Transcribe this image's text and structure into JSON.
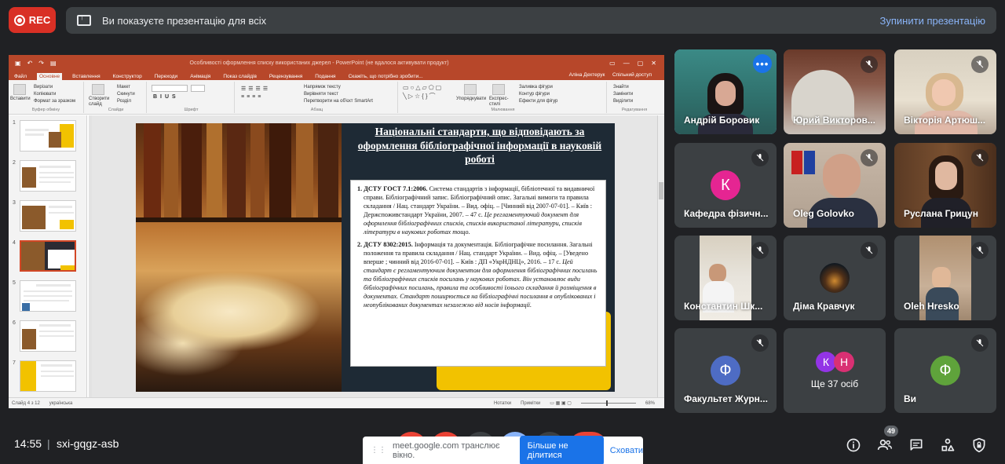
{
  "rec_label": "REC",
  "presenting": {
    "text": "Ви показуєте презентацію для всіх",
    "stop_label": "Зупинити презентацію"
  },
  "ppt": {
    "window_title": "Особливості оформлення списку використаних джерел - PowerPoint (не вдалося активувати продукт)",
    "user": "Аліна Дехтерук",
    "share": "Спільний доступ",
    "tabs": [
      "Файл",
      "Основне",
      "Вставлення",
      "Конструктор",
      "Переходи",
      "Анімація",
      "Показ слайдів",
      "Рецензування",
      "Подання"
    ],
    "tell_me": "Скажіть, що потрібно зробити...",
    "ribbon": {
      "paste": "Вставити",
      "cut": "Вирізати",
      "copy": "Копіювати",
      "format_painter": "Формат за зразком",
      "clipboard": "Буфер обміну",
      "new_slide": "Створити слайд",
      "layout": "Макет",
      "reset": "Скинути",
      "section": "Розділ",
      "slides": "Слайди",
      "font": "Шрифт",
      "text_dir": "Напрямок тексту",
      "align_text": "Вирівняти текст",
      "smartart": "Перетворити на об'єкт SmartArt",
      "paragraph": "Абзац",
      "arrange": "Упорядкувати",
      "quick_styles": "Експрес-стилі",
      "shape_fill": "Заливка фігури",
      "shape_outline": "Контур фігури",
      "shape_effects": "Ефекти для фігур",
      "drawing": "Малювання",
      "find": "Знайти",
      "replace": "Замінити",
      "select": "Виділити",
      "editing": "Редагування"
    },
    "slide_numbers": [
      "1",
      "2",
      "3",
      "4",
      "5",
      "6",
      "7"
    ],
    "status": {
      "slide": "Слайд 4 з 12",
      "lang": "українська",
      "notes": "Нотатки",
      "comments": "Примітки",
      "zoom": "68%"
    },
    "slide": {
      "title": "Національні стандарти, що відповідають за оформлення бібліографічної інформації в науковій роботі",
      "item1_bold": "1. ДСТУ ГОСТ 7.1:2006.",
      "item1_text": " Система стандартів з інформації, бібліотечної та видавничої справи. Бібліографічний запис. Бібліографічний опис. Загальні вимоги та правила складання / Нац. стандарт України. – Вид. офіц. – [Чинний від 2007-07-01]. – Київ : Держспоживстандарт України, 2007. – 47 с. ",
      "item1_italic": "Це регламентуючий документ для оформлення бібліографічних списків, списків використаної літератури, списків літератури в наукових роботах тощо.",
      "item2_bold": "2. ДСТУ 8302:2015.",
      "item2_text": " Інформація та документація. Бібліографічне посилання. Загальні положення та правила складання / Нац. стандарт України. – Вид. офіц. – [Уведено вперше ; чинний від 2016-07-01]. – Київ : ДП «УкрНДНЦ», 2016. – 17 с. ",
      "item2_italic": "Цей стандарт є регламентуючим документом для оформлення бібліографічних посилань та бібліографічних списків посилань у наукових роботах. Він установлює види бібліографічних посилань, правила та особливості їхнього складання й розміщення в документах. Стандарт поширюється на бібліографічні посилання в опублікованих і неопублікованих документах незалежно від носія інформації."
    }
  },
  "participants": [
    {
      "name": "Андрій Боровик",
      "type": "video",
      "active": true
    },
    {
      "name": "Юрий Викторов...",
      "type": "video",
      "muted": true
    },
    {
      "name": "Вікторія Артюш...",
      "type": "video",
      "muted": true
    },
    {
      "name": "Кафедра фізичн...",
      "type": "avatar",
      "initial": "К",
      "color": "#e52592",
      "muted": true
    },
    {
      "name": "Oleg Golovko",
      "type": "video",
      "muted": true
    },
    {
      "name": "Руслана Грицун",
      "type": "video",
      "muted": true
    },
    {
      "name": "Константин Шк...",
      "type": "video",
      "muted": true
    },
    {
      "name": "Діма Кравчук",
      "type": "photo",
      "muted": true
    },
    {
      "name": "Oleh Hresko",
      "type": "video",
      "muted": true
    },
    {
      "name": "Факультет Журн...",
      "type": "avatar",
      "initial": "Ф",
      "color": "#4e6cc4",
      "muted": true
    },
    {
      "name": "Ще 37 осіб",
      "type": "group",
      "initials": [
        "К",
        "Н"
      ]
    },
    {
      "name": "Ви",
      "type": "avatar",
      "initial": "Ф",
      "color": "#5fa33b",
      "muted": true
    }
  ],
  "bottom": {
    "time": "14:55",
    "separator": "|",
    "meeting_code": "sxi-gqgz-asb",
    "people_count": "49",
    "notice_text": "meet.google.com транслює вікно.",
    "stop_sharing": "Більше не ділитися",
    "hide": "Сховати"
  }
}
